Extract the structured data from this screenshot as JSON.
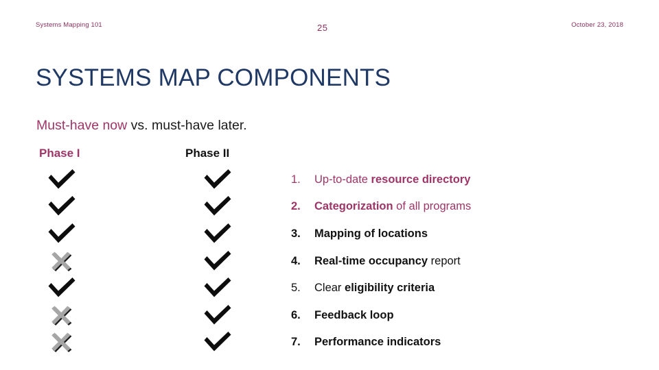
{
  "header": {
    "left_label": "Systems Mapping 101",
    "slide_number": "25",
    "date": "October 23, 2018",
    "color": "#8A2F5C"
  },
  "title": {
    "text": "SYSTEMS MAP COMPONENTS",
    "color": "#1F3864"
  },
  "subtitle": {
    "accent_text": "Must-have now",
    "rest_text": " vs. must-have later.",
    "accent_color": "#9E3567",
    "rest_color": "#1a1a1a"
  },
  "columns": {
    "phase_one": {
      "label": "Phase I",
      "color": "#9E3567",
      "marks": [
        "check",
        "check",
        "check",
        "cross",
        "check",
        "cross",
        "cross"
      ]
    },
    "phase_two": {
      "label": "Phase II",
      "color": "#111111",
      "marks": [
        "check",
        "check",
        "check",
        "check",
        "check",
        "check",
        "check"
      ]
    }
  },
  "list": {
    "items": [
      {
        "number": "1.",
        "plain_before": "Up-to-date ",
        "bold": "resource directory",
        "plain_after": "",
        "color": "#9E3567",
        "number_bold": false
      },
      {
        "number": "2.",
        "plain_before": "",
        "bold": "Categorization",
        "plain_after": " of all programs",
        "color": "#9E3567",
        "number_bold": true
      },
      {
        "number": "3.",
        "plain_before": "",
        "bold": "Mapping of locations",
        "plain_after": "",
        "color": "#111111",
        "number_bold": true
      },
      {
        "number": "4.",
        "plain_before": "",
        "bold": "Real-time occupancy",
        "plain_after": " report",
        "color": "#111111",
        "number_bold": true
      },
      {
        "number": "5.",
        "plain_before": "Clear ",
        "bold": "eligibility criteria",
        "plain_after": "",
        "color": "#111111",
        "number_bold": false
      },
      {
        "number": "6.",
        "plain_before": "",
        "bold": "Feedback loop",
        "plain_after": "",
        "color": "#111111",
        "number_bold": true
      },
      {
        "number": "7.",
        "plain_before": "",
        "bold": "Performance indicators",
        "plain_after": "",
        "color": "#111111",
        "number_bold": true
      }
    ]
  },
  "icons": {
    "check_color": "#0D0D0D",
    "cross_fill": "#A6A6A6",
    "cross_shadow": "#1A1A1A"
  }
}
